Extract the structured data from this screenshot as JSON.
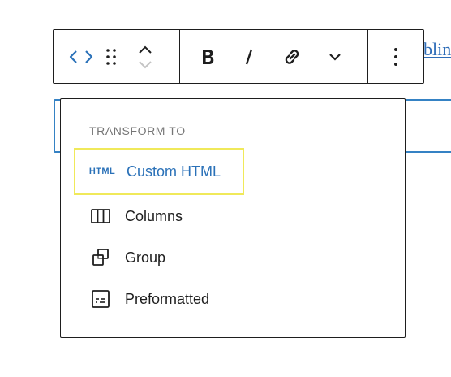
{
  "editor": {
    "partial_link_text": "blin"
  },
  "toolbar": {
    "buttons": [
      {
        "name": "custom-html-block-type",
        "icon": "code-icon"
      },
      {
        "name": "drag-handle",
        "icon": "drag-icon"
      },
      {
        "name": "move-up",
        "icon": "chevron-up-icon"
      },
      {
        "name": "move-down",
        "icon": "chevron-down-icon"
      },
      {
        "name": "bold",
        "icon": "bold-icon"
      },
      {
        "name": "italic",
        "icon": "italic-icon"
      },
      {
        "name": "link",
        "icon": "link-icon"
      },
      {
        "name": "more-rich-text",
        "icon": "chevron-down-icon"
      },
      {
        "name": "options",
        "icon": "kebab-icon"
      }
    ]
  },
  "transform_menu": {
    "heading": "TRANSFORM TO",
    "items": [
      {
        "label": "Custom HTML",
        "icon": "html-icon",
        "icon_text": "HTML",
        "highlighted": true
      },
      {
        "label": "Columns",
        "icon": "columns-icon"
      },
      {
        "label": "Group",
        "icon": "group-icon"
      },
      {
        "label": "Preformatted",
        "icon": "preformatted-icon"
      }
    ]
  },
  "colors": {
    "accent": "#2a71b8",
    "text": "#1e1e1e",
    "muted": "#757575",
    "highlight_border": "#f0e95a",
    "block_outline": "#3582c4"
  }
}
